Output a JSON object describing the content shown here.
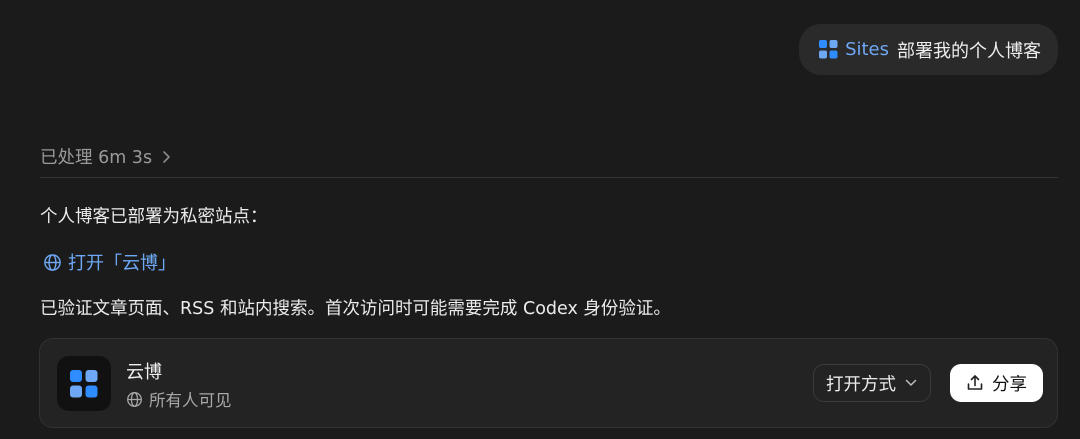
{
  "user_message": {
    "chip_label": "Sites",
    "text": "部署我的个人博客"
  },
  "processed": {
    "label": "已处理 6m 3s"
  },
  "assistant": {
    "intro": "个人博客已部署为私密站点：",
    "link_label": "打开「云博」",
    "note": "已验证文章页面、RSS 和站内搜索。首次访问时可能需要完成 Codex 身份验证。"
  },
  "site_card": {
    "name": "云博",
    "visibility": "所有人可见",
    "open_with_label": "打开方式",
    "share_label": "分享"
  },
  "colors": {
    "background": "#1b1b1b",
    "accent": "#6ea8f5",
    "app_icon_blue": "#2f8cff"
  },
  "icons": {
    "sites": "grid-squares-icon",
    "processed_chevron": "chevron-right-icon",
    "link": "globe-icon",
    "visibility": "globe-icon",
    "open_with_chevron": "chevron-down-icon",
    "share": "upload-icon"
  }
}
